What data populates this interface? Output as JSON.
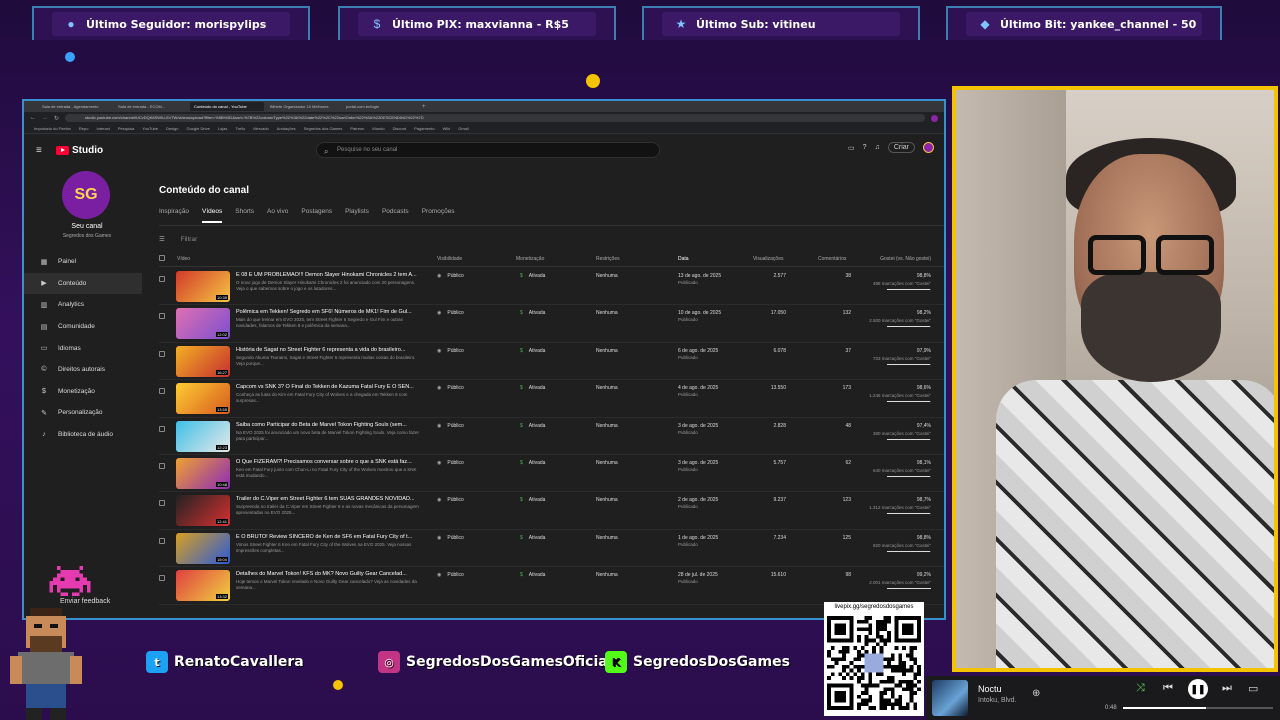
{
  "alerts": [
    {
      "icon": "user-icon",
      "text": "Último Seguidor: morispylips"
    },
    {
      "icon": "dollar-icon",
      "text": "Último PIX: maxvianna - R$5"
    },
    {
      "icon": "star-icon",
      "text": "Último Sub: vitineu"
    },
    {
      "icon": "diamond-icon",
      "text": "Último Bit: yankee_channel - 50"
    }
  ],
  "browser": {
    "tabs": [
      "Sala de entrada - Agendamento",
      "Sala de entrada - ECOM...",
      "Conteúdo do canal - YouTube",
      "Bilhete Organizador 10 Melhores",
      "portal.com.br/login"
    ],
    "active_tab": 2,
    "url": "studio.youtube.com/channel/UCvDQK8SWIU-EvTW/videos/upload?filter=%5B%5D&sort=%7B%22columnType%22%3A%22date%22%2C%22sortOrder%22%3A%22DESCENDING%22%7D",
    "bookmarks": [
      "Importado do Firefox",
      "Repo",
      "Interact",
      "Pesquisa",
      "YouTube",
      "Design",
      "Google Drive",
      "Lojas",
      "Trello",
      "Mercado",
      "Anotações",
      "Segredos dos Games",
      "Patreon",
      "Mundo",
      "Discord",
      "Pagamento",
      "Wiki",
      "Gmail"
    ]
  },
  "studio": {
    "brand": "Studio",
    "search_placeholder": "Pesquise no seu canal",
    "create_label": "Criar",
    "channel_label": "Seu canal",
    "channel_name": "Segredos dos Games",
    "nav": [
      {
        "icon": "dashboard-icon",
        "label": "Painel",
        "active": false
      },
      {
        "icon": "video-library-icon",
        "label": "Conteúdo",
        "active": true
      },
      {
        "icon": "analytics-icon",
        "label": "Analytics",
        "active": false
      },
      {
        "icon": "comments-icon",
        "label": "Comunidade",
        "active": false
      },
      {
        "icon": "subtitles-icon",
        "label": "Idiomas",
        "active": false
      },
      {
        "icon": "copyright-icon",
        "label": "Direitos autorais",
        "active": false
      },
      {
        "icon": "monetization-icon",
        "label": "Monetização",
        "active": false
      },
      {
        "icon": "customization-icon",
        "label": "Personalização",
        "active": false
      },
      {
        "icon": "audio-library-icon",
        "label": "Biblioteca de áudio",
        "active": false
      }
    ],
    "feedback": "Enviar feedback",
    "page_title": "Conteúdo do canal",
    "content_tabs": [
      "Inspiração",
      "Vídeos",
      "Shorts",
      "Ao vivo",
      "Postagens",
      "Playlists",
      "Podcasts",
      "Promoções"
    ],
    "active_content_tab": 1,
    "filter_placeholder": "Filtrar",
    "columns": {
      "video": "Vídeo",
      "visibility": "Visibilidade",
      "monetization": "Monetização",
      "restrictions": "Restrições",
      "date": "Data",
      "views": "Visualizações",
      "comments": "Comentários",
      "likes": "Gostei (vs. Não gostei)"
    },
    "videos": [
      {
        "title": "É 08 É UM PROBLEMÃO!!! Demon Slayer Hinokami Chronicles 2 tem A...",
        "desc": "O novo jogo de Demon Slayer Hinokami Chronicles 2 foi anunciado com 20 personagens. Veja o que sabemos sobre o jogo e os lutadores...",
        "duration": "10:39",
        "visibility": "Público",
        "monetization": "Ativada",
        "restrictions": "Nenhuma",
        "date": "13 de ago. de 2025",
        "date_sub": "Publicado",
        "views": "2.577",
        "comments": "38",
        "likes": "98,8%",
        "likes_sub": "498 marcações com \"Gostei\"",
        "like_ratio": 0.988,
        "thumb": [
          "#d23a2a",
          "#f5c542"
        ]
      },
      {
        "title": "Polêmica em Tekken! Segredo em SF6! Números de MK1! Fim de Gul...",
        "desc": "Mais do que treinar em EVO 2025, tem Street Fighter 6 Segredo e Gul Fim e outras novidades, falamos de Tekken 8 e polêmica da semana...",
        "duration": "12:02",
        "visibility": "Público",
        "monetization": "Ativada",
        "restrictions": "Nenhuma",
        "date": "10 de ago. de 2025",
        "date_sub": "Publicado",
        "views": "17.050",
        "comments": "132",
        "likes": "98,2%",
        "likes_sub": "2.500 marcações com \"Gostei\"",
        "like_ratio": 0.982,
        "thumb": [
          "#e070b0",
          "#7b4fd0"
        ]
      },
      {
        "title": "História de Sagat no Street Fighter 6 representa a vida do brasileiro...",
        "desc": "Segundo Akuma Tsunami, Sagat e Street Fighter 6 representa muitas coisas do brasileiro. Veja porque...",
        "duration": "16:27",
        "visibility": "Público",
        "monetization": "Ativada",
        "restrictions": "Nenhuma",
        "date": "6 de ago. de 2025",
        "date_sub": "Publicado",
        "views": "6.078",
        "comments": "37",
        "likes": "97,9%",
        "likes_sub": "733 marcações com \"Gostei\"",
        "like_ratio": 0.979,
        "thumb": [
          "#f2b024",
          "#c72f2f"
        ]
      },
      {
        "title": "Capcom vs SNK 3? O Final do Tekken de Kazuma Fatal Fury É O SEN...",
        "desc": "Conheça as lutas do Kim em Fatal Fury City of Wolves e a chegada em Tekken 8 com surpresas...",
        "duration": "13:55",
        "visibility": "Público",
        "monetization": "Ativada",
        "restrictions": "Nenhuma",
        "date": "4 de ago. de 2025",
        "date_sub": "Publicado",
        "views": "13.550",
        "comments": "173",
        "likes": "98,6%",
        "likes_sub": "1.246 marcações com \"Gostei\"",
        "like_ratio": 0.986,
        "thumb": [
          "#ffcc33",
          "#d65b1e"
        ]
      },
      {
        "title": "Saiba como Participar do Beta de Marvel Tokon Fighting Souls (sem...",
        "desc": "Na EVO 2025 foi anunciado um novo beta de Marvel Tokon Fighting Souls. Veja como fazer para participar...",
        "duration": "12:23",
        "visibility": "Público",
        "monetization": "Ativada",
        "restrictions": "Nenhuma",
        "date": "3 de ago. de 2025",
        "date_sub": "Publicado",
        "views": "2.828",
        "comments": "48",
        "likes": "97,4%",
        "likes_sub": "380 marcações com \"Gostei\"",
        "like_ratio": 0.974,
        "thumb": [
          "#3ec0e8",
          "#e8e8e8"
        ]
      },
      {
        "title": "O Que FIZERAM?! Precisamos conversar sobre o que a SNK está faz...",
        "desc": "Ken em Fatal Fury junto com Chun-Li no Fatal Fury City of the Wolves mostrou que a SNK está mudando...",
        "duration": "10:48",
        "visibility": "Público",
        "monetization": "Ativada",
        "restrictions": "Nenhuma",
        "date": "3 de ago. de 2025",
        "date_sub": "Publicado",
        "views": "5.757",
        "comments": "62",
        "likes": "98,1%",
        "likes_sub": "640 marcações com \"Gostei\"",
        "like_ratio": 0.981,
        "thumb": [
          "#f0a030",
          "#8c2bb8"
        ]
      },
      {
        "title": "Trailer do C.Viper em Street Fighter 6 tem SUAS GRANDES NOVIDAD...",
        "desc": "Surpreenda no trailer da C.Viper em Street Fighter 6 e as novas mecânicas da personagem apresentadas no EVO 2025...",
        "duration": "12:41",
        "visibility": "Público",
        "monetization": "Ativada",
        "restrictions": "Nenhuma",
        "date": "2 de ago. de 2025",
        "date_sub": "Publicado",
        "views": "9.237",
        "comments": "123",
        "likes": "98,7%",
        "likes_sub": "1.312 marcações com \"Gostei\"",
        "like_ratio": 0.987,
        "thumb": [
          "#222222",
          "#d83030"
        ]
      },
      {
        "title": "É O BRUTO! Review SINCERO de Ken de SF6 em Fatal Fury City of t...",
        "desc": "Vimos Street Fighter 6 Ken em Fatal Fury City of the Wolves na EVO 2025. Veja nossas impressões completas...",
        "duration": "15:04",
        "visibility": "Público",
        "monetization": "Ativada",
        "restrictions": "Nenhuma",
        "date": "1 de ago. de 2025",
        "date_sub": "Publicado",
        "views": "7.234",
        "comments": "125",
        "likes": "98,8%",
        "likes_sub": "820 marcações com \"Gostei\"",
        "like_ratio": 0.988,
        "thumb": [
          "#d8a020",
          "#2a5ad8"
        ]
      },
      {
        "title": "Detalhes do Marvel Tokon! KFS do MK? Novo Guilty Gear Cancelad...",
        "desc": "Hoje temos o Marvel Tokon revelado e Novo Guilty Gear cancelado? Veja as novidades da semana...",
        "duration": "13:32",
        "visibility": "Público",
        "monetization": "Ativada",
        "restrictions": "Nenhuma",
        "date": "28 de jul. de 2025",
        "date_sub": "Publicado",
        "views": "15.610",
        "comments": "98",
        "likes": "99,2%",
        "likes_sub": "2.001 marcações com \"Gostei\"",
        "like_ratio": 0.992,
        "thumb": [
          "#e04040",
          "#f0d040"
        ]
      }
    ]
  },
  "socials": [
    {
      "icon": "twitter-icon",
      "name": "RenatoCavallera",
      "color": "#1da1f2"
    },
    {
      "icon": "instagram-icon",
      "name": "SegredosDosGamesOficial",
      "color": "#c13584"
    },
    {
      "icon": "kick-icon",
      "name": "SegredosDosGames",
      "color": "#53fc18"
    }
  ],
  "qr": {
    "url": "livepix.gg/segredosdosgames"
  },
  "player": {
    "song": "Noctu",
    "artist": "Intoku, Blvd.",
    "time": "0:48",
    "progress": 0.55
  },
  "colors": {
    "accent": "#3a8fd0",
    "cam_border": "#f4c400",
    "bg": "#2b0d4d"
  }
}
